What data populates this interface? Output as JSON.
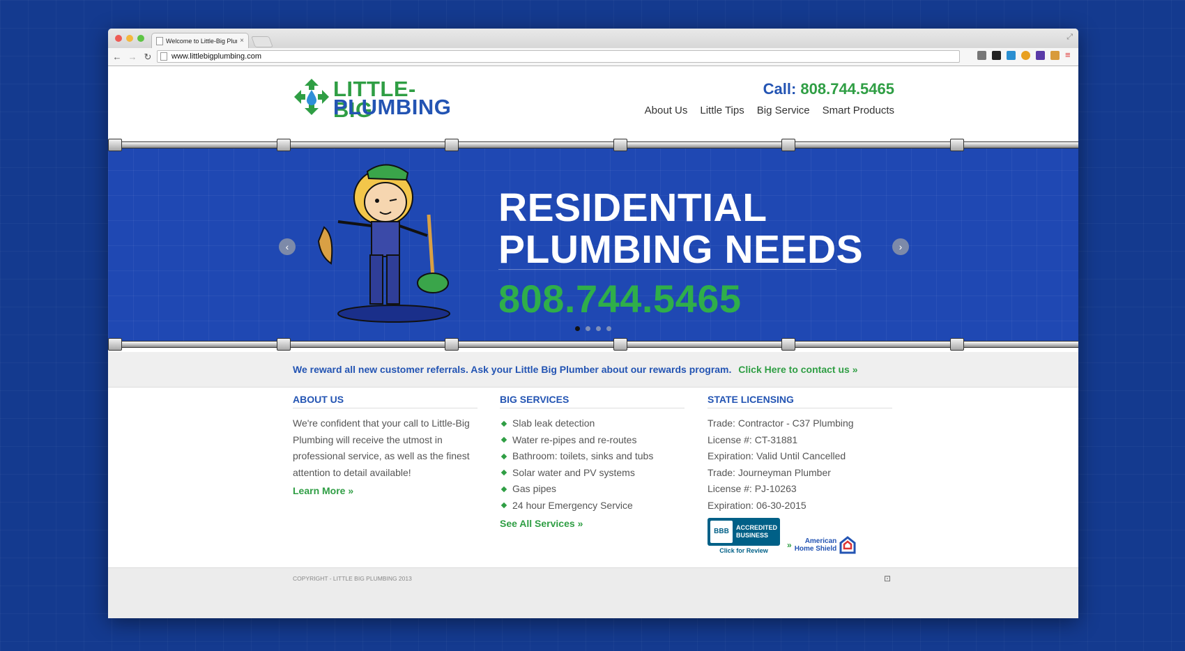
{
  "browser": {
    "tab_title": "Welcome to Little-Big Plum",
    "tab_close": "×",
    "url": "www.littlebigplumbing.com",
    "nav_back": "←",
    "nav_forward": "→",
    "nav_reload": "↻",
    "resize": "⤢"
  },
  "header": {
    "logo_line1": "LITTLE-BIG",
    "logo_line2": "PLUMBING",
    "call_label": "Call:",
    "call_number": "808.744.5465",
    "nav": [
      "About Us",
      "Little Tips",
      "Big Service",
      "Smart Products"
    ]
  },
  "banner": {
    "headline_line1": "RESIDENTIAL",
    "headline_line2": "PLUMBING NEEDS",
    "phone": "808.744.5465",
    "prev": "‹",
    "next": "›",
    "slide_count": 4,
    "active_slide": 1
  },
  "referral": {
    "text": "We reward all new customer referrals. Ask your Little Big Plumber about our rewards program.",
    "link": "Click Here to contact us"
  },
  "about": {
    "title": "ABOUT US",
    "text": "We're confident that your call to Little-Big Plumbing will receive the utmost in professional service, as well as the finest attention to detail available!",
    "link": "Learn More"
  },
  "services": {
    "title": "BIG SERVICES",
    "items": [
      "Slab leak detection",
      "Water re-pipes and re-routes",
      "Bathroom: toilets, sinks and tubs",
      "Solar water and PV systems",
      "Gas pipes",
      "24 hour Emergency Service"
    ],
    "link": "See All Services"
  },
  "licensing": {
    "title": "STATE LICENSING",
    "lines": [
      "Trade: Contractor - C37 Plumbing",
      "License #: CT-31881",
      "Expiration: Valid Until Cancelled",
      "Trade: Journeyman Plumber",
      "License #: PJ-10263",
      "Expiration: 06-30-2015"
    ],
    "bbb_logo": "BBB",
    "bbb_line1": "ACCREDITED",
    "bbb_line2": "BUSINESS",
    "bbb_review": "Click for Review",
    "ahs_line1": "American",
    "ahs_line2": "Home Shield"
  },
  "footer": {
    "copyright": "COPYRIGHT - LITTLE BIG PLUMBING 2013",
    "icon": "⊡"
  },
  "colors": {
    "brand_blue": "#2354b3",
    "brand_green": "#2f9e44",
    "banner_blue": "#1f48b3",
    "page_bg": "#143a8f"
  }
}
